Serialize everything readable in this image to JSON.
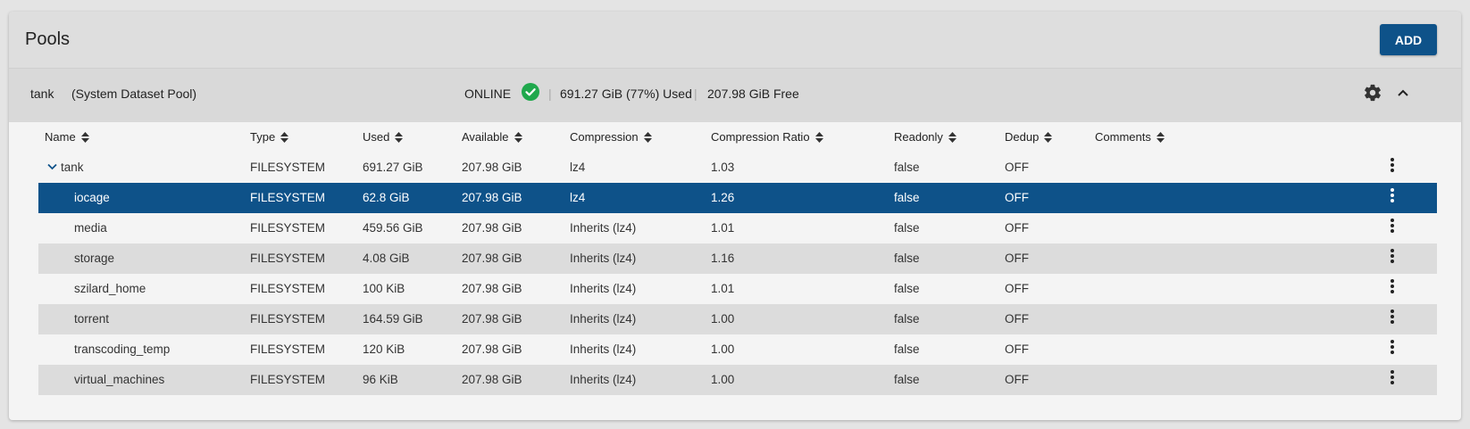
{
  "header": {
    "title": "Pools",
    "add_label": "ADD"
  },
  "pool": {
    "name": "tank",
    "role": "(System Dataset Pool)",
    "status": "ONLINE",
    "status_icon": "check-circle-icon",
    "status_color": "#1fa84c",
    "separator": "|",
    "used": "691.27 GiB (77%) Used",
    "free": "207.98 GiB Free"
  },
  "table": {
    "columns": [
      "Name",
      "Type",
      "Used",
      "Available",
      "Compression",
      "Compression Ratio",
      "Readonly",
      "Dedup",
      "Comments"
    ],
    "rows": [
      {
        "name": "tank",
        "type": "FILESYSTEM",
        "used": "691.27 GiB",
        "available": "207.98 GiB",
        "compression": "lz4",
        "ratio": "1.03",
        "readonly": "false",
        "dedup": "OFF",
        "comments": ""
      },
      {
        "name": "iocage",
        "type": "FILESYSTEM",
        "used": "62.8 GiB",
        "available": "207.98 GiB",
        "compression": "lz4",
        "ratio": "1.26",
        "readonly": "false",
        "dedup": "OFF",
        "comments": ""
      },
      {
        "name": "media",
        "type": "FILESYSTEM",
        "used": "459.56 GiB",
        "available": "207.98 GiB",
        "compression": "Inherits (lz4)",
        "ratio": "1.01",
        "readonly": "false",
        "dedup": "OFF",
        "comments": ""
      },
      {
        "name": "storage",
        "type": "FILESYSTEM",
        "used": "4.08 GiB",
        "available": "207.98 GiB",
        "compression": "Inherits (lz4)",
        "ratio": "1.16",
        "readonly": "false",
        "dedup": "OFF",
        "comments": ""
      },
      {
        "name": "szilard_home",
        "type": "FILESYSTEM",
        "used": "100 KiB",
        "available": "207.98 GiB",
        "compression": "Inherits (lz4)",
        "ratio": "1.01",
        "readonly": "false",
        "dedup": "OFF",
        "comments": ""
      },
      {
        "name": "torrent",
        "type": "FILESYSTEM",
        "used": "164.59 GiB",
        "available": "207.98 GiB",
        "compression": "Inherits (lz4)",
        "ratio": "1.00",
        "readonly": "false",
        "dedup": "OFF",
        "comments": ""
      },
      {
        "name": "transcoding_temp",
        "type": "FILESYSTEM",
        "used": "120 KiB",
        "available": "207.98 GiB",
        "compression": "Inherits (lz4)",
        "ratio": "1.00",
        "readonly": "false",
        "dedup": "OFF",
        "comments": ""
      },
      {
        "name": "virtual_machines",
        "type": "FILESYSTEM",
        "used": "96 KiB",
        "available": "207.98 GiB",
        "compression": "Inherits (lz4)",
        "ratio": "1.00",
        "readonly": "false",
        "dedup": "OFF",
        "comments": ""
      }
    ],
    "selected_row": 1
  },
  "colors": {
    "accent": "#0e5289",
    "selected_text": "#ffffff"
  }
}
